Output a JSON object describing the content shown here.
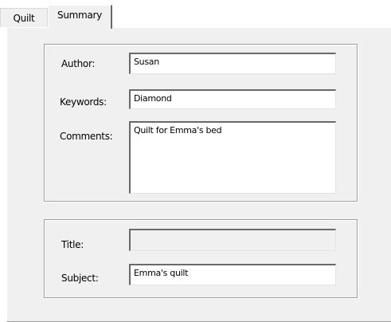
{
  "tabs": [
    {
      "label": "Quilt",
      "selected": false
    },
    {
      "label": "Summary",
      "selected": true
    }
  ],
  "summary_group": {
    "author_label": "Author:",
    "author_value": "Susan",
    "keywords_label": "Keywords:",
    "keywords_value": "Diamond",
    "comments_label": "Comments:",
    "comments_value": "Quilt for Emma's bed"
  },
  "title_group": {
    "title_label": "Title:",
    "title_value": "",
    "title_enabled": false,
    "subject_label": "Subject:",
    "subject_value": "Emma's quilt"
  },
  "colors": {
    "face": "#f0f0f0",
    "field_background": "#ffffff",
    "shadow": "#696969",
    "group_border": "#a0a0a0"
  }
}
